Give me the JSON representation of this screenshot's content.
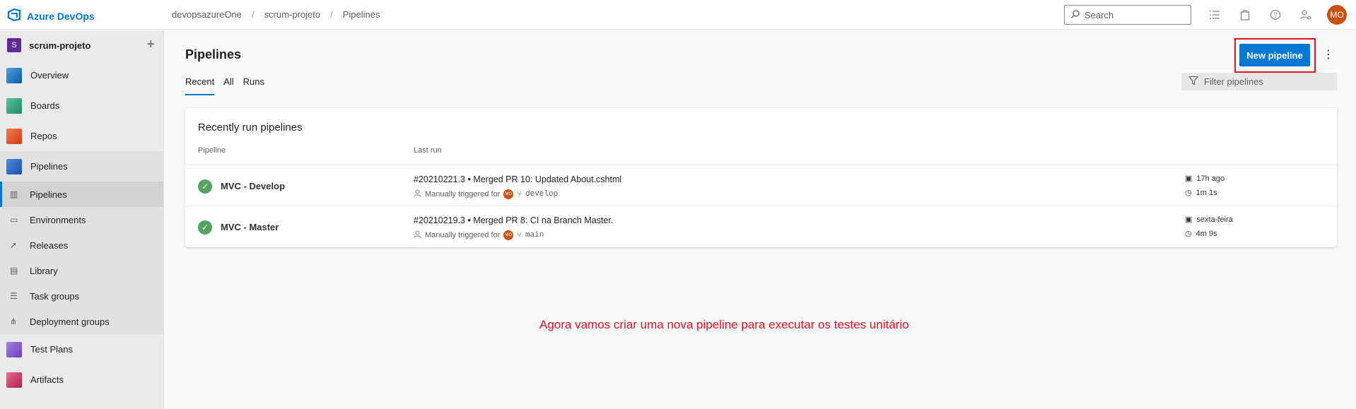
{
  "app": {
    "name": "Azure DevOps"
  },
  "breadcrumb": [
    "devopsazureOne",
    "scrum-projeto",
    "Pipelines"
  ],
  "search": {
    "placeholder": "Search"
  },
  "user": {
    "initials": "MO"
  },
  "sidebar": {
    "project": {
      "badge": "S",
      "name": "scrum-projeto"
    },
    "items": [
      {
        "label": "Overview"
      },
      {
        "label": "Boards"
      },
      {
        "label": "Repos"
      },
      {
        "label": "Pipelines"
      },
      {
        "label": "Test Plans"
      },
      {
        "label": "Artifacts"
      }
    ],
    "pipelines_sub": [
      {
        "label": "Pipelines"
      },
      {
        "label": "Environments"
      },
      {
        "label": "Releases"
      },
      {
        "label": "Library"
      },
      {
        "label": "Task groups"
      },
      {
        "label": "Deployment groups"
      }
    ]
  },
  "main": {
    "title": "Pipelines",
    "tabs": [
      "Recent",
      "All",
      "Runs"
    ],
    "new_button": "New pipeline",
    "filter_placeholder": "Filter pipelines",
    "card_title": "Recently run pipelines",
    "columns": [
      "Pipeline",
      "Last run"
    ],
    "rows": [
      {
        "name": "MVC - Develop",
        "run": "#20210221.3 • Merged PR 10: Updated About.cshtml",
        "trigger": "Manually triggered for",
        "branch": "develop",
        "when": "17h ago",
        "duration": "1m 1s"
      },
      {
        "name": "MVC - Master",
        "run": "#20210219.3 • Merged PR 8: CI na Branch Master.",
        "trigger": "Manually triggered for",
        "branch": "main",
        "when": "sexta-feira",
        "duration": "4m 9s"
      }
    ]
  },
  "annotation": "Agora vamos criar uma nova pipeline para executar os testes unitário",
  "colors": {
    "accent": "#0078d4",
    "success": "#55a362",
    "annotation": "#e81123"
  }
}
